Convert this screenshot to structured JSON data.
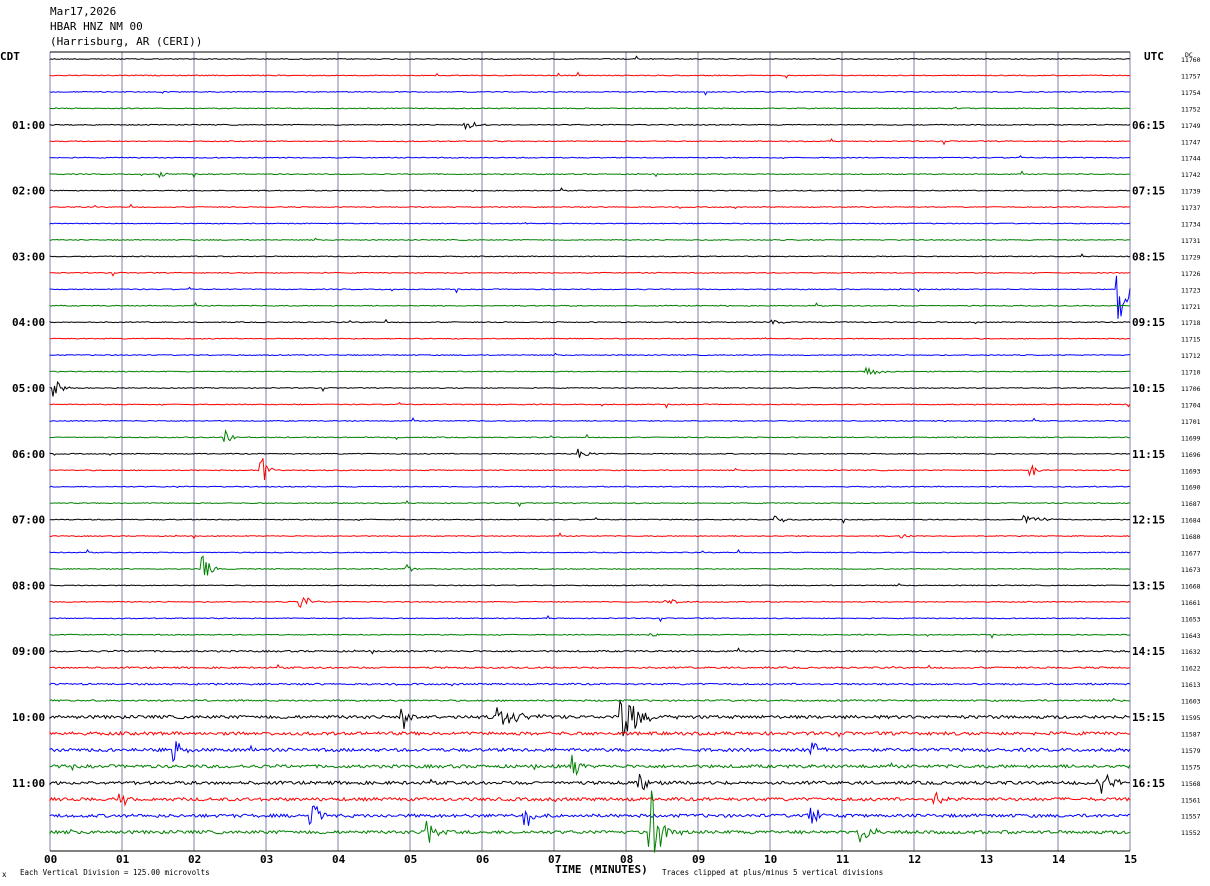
{
  "header": {
    "date": "Mar17,2026",
    "station": "HBAR HNZ NM 00",
    "location": "(Harrisburg, AR (CERI))"
  },
  "left_label": "CDT",
  "right_label": "UTC",
  "dc_label": "DC",
  "footer": {
    "mark": "x",
    "division": "Each Vertical Division =  125.00 microvolts",
    "clip": "Traces clipped at plus/minus 5 vertical divisions"
  },
  "chart_data": {
    "type": "line",
    "title": "Mar17,2026 HBAR HNZ NM 00 (Harrisburg, AR (CERI))",
    "xlabel": "TIME (MINUTES)",
    "x_ticks": [
      "00",
      "01",
      "02",
      "03",
      "04",
      "05",
      "06",
      "07",
      "08",
      "09",
      "10",
      "11",
      "12",
      "13",
      "14",
      "15"
    ],
    "xlim": [
      0,
      15
    ],
    "trace_colors": [
      "#000000",
      "#ff0000",
      "#0000ff",
      "#008000"
    ],
    "grid": true,
    "left_hour_labels": [
      "01:00",
      "02:00",
      "03:00",
      "04:00",
      "05:00",
      "06:00",
      "07:00",
      "08:00",
      "09:00",
      "10:00",
      "11:00"
    ],
    "right_hour_labels": [
      "06:15",
      "07:15",
      "08:15",
      "09:15",
      "10:15",
      "11:15",
      "12:15",
      "13:15",
      "14:15",
      "15:15",
      "16:15"
    ],
    "dc_offsets": [
      11760,
      11757,
      11754,
      11752,
      11749,
      11747,
      11744,
      11742,
      11739,
      11737,
      11734,
      11731,
      11729,
      11726,
      11723,
      11721,
      11718,
      11715,
      11712,
      11710,
      11706,
      11704,
      11701,
      11699,
      11696,
      11693,
      11690,
      11687,
      11684,
      11680,
      11677,
      11673,
      11668,
      11661,
      11653,
      11643,
      11632,
      11622,
      11613,
      11603,
      11595,
      11587,
      11579,
      11575,
      11568,
      11561,
      11557,
      11552
    ],
    "events": [
      {
        "line": 4,
        "minute": 5.8,
        "amp": 0.25,
        "dur": 0.5
      },
      {
        "line": 7,
        "minute": 1.55,
        "amp": 0.2,
        "dur": 0.3
      },
      {
        "line": 14,
        "minute": 14.85,
        "amp": 2.4,
        "dur": 0.5
      },
      {
        "line": 16,
        "minute": 10.05,
        "amp": 0.15,
        "dur": 0.4
      },
      {
        "line": 19,
        "minute": 11.35,
        "amp": 0.5,
        "dur": 0.4
      },
      {
        "line": 20,
        "minute": 0.05,
        "amp": 0.6,
        "dur": 0.4
      },
      {
        "line": 23,
        "minute": 2.45,
        "amp": 0.45,
        "dur": 0.4
      },
      {
        "line": 24,
        "minute": 7.35,
        "amp": 0.35,
        "dur": 0.6
      },
      {
        "line": 25,
        "minute": 2.95,
        "amp": 0.9,
        "dur": 0.3
      },
      {
        "line": 25,
        "minute": 13.65,
        "amp": 0.35,
        "dur": 0.3
      },
      {
        "line": 28,
        "minute": 10.1,
        "amp": 0.25,
        "dur": 0.5
      },
      {
        "line": 28,
        "minute": 13.55,
        "amp": 0.3,
        "dur": 0.8
      },
      {
        "line": 29,
        "minute": 11.85,
        "amp": 0.2,
        "dur": 0.3
      },
      {
        "line": 31,
        "minute": 2.15,
        "amp": 0.8,
        "dur": 0.3
      },
      {
        "line": 31,
        "minute": 4.95,
        "amp": 0.3,
        "dur": 0.3
      },
      {
        "line": 33,
        "minute": 3.5,
        "amp": 0.5,
        "dur": 0.4
      },
      {
        "line": 33,
        "minute": 8.55,
        "amp": 0.35,
        "dur": 0.5
      },
      {
        "line": 35,
        "minute": 8.35,
        "amp": 0.15,
        "dur": 0.3
      },
      {
        "line": 40,
        "minute": 7.95,
        "amp": 1.6,
        "dur": 0.8
      },
      {
        "line": 40,
        "minute": 6.25,
        "amp": 0.8,
        "dur": 0.8
      },
      {
        "line": 40,
        "minute": 4.9,
        "amp": 1.0,
        "dur": 0.2
      },
      {
        "line": 42,
        "minute": 10.6,
        "amp": 0.5,
        "dur": 0.4
      },
      {
        "line": 42,
        "minute": 1.75,
        "amp": 0.8,
        "dur": 0.3
      },
      {
        "line": 43,
        "minute": 7.3,
        "amp": 0.9,
        "dur": 0.2
      },
      {
        "line": 44,
        "minute": 14.55,
        "amp": 0.8,
        "dur": 0.8
      },
      {
        "line": 44,
        "minute": 8.2,
        "amp": 0.6,
        "dur": 0.5
      },
      {
        "line": 45,
        "minute": 1.0,
        "amp": 0.5,
        "dur": 0.3
      },
      {
        "line": 45,
        "minute": 12.3,
        "amp": 0.5,
        "dur": 0.4
      },
      {
        "line": 46,
        "minute": 10.55,
        "amp": 1.5,
        "dur": 0.4
      },
      {
        "line": 46,
        "minute": 6.6,
        "amp": 0.8,
        "dur": 0.5
      },
      {
        "line": 46,
        "minute": 3.65,
        "amp": 1.2,
        "dur": 0.3
      },
      {
        "line": 47,
        "minute": 8.35,
        "amp": 2.6,
        "dur": 0.5
      },
      {
        "line": 47,
        "minute": 5.25,
        "amp": 1.3,
        "dur": 0.3
      },
      {
        "line": 47,
        "minute": 11.25,
        "amp": 0.9,
        "dur": 0.5
      }
    ]
  }
}
